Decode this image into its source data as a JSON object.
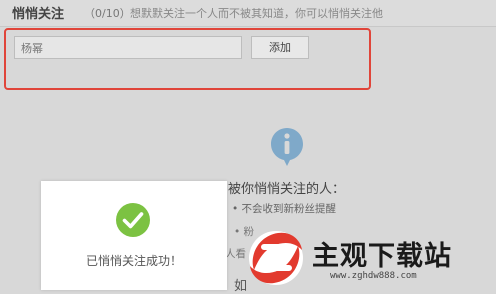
{
  "header": {
    "title": "悄悄关注",
    "count": "（0/10）",
    "description": "想默默关注一个人而不被其知道，你可以悄悄关注他"
  },
  "form": {
    "input_value": "杨幂",
    "add_label": "添加"
  },
  "info_panel": {
    "icon": "info-icon",
    "title": "被你悄悄关注的人：",
    "bullet_1": "• 不会收到新粉丝提醒",
    "fragment_1": "• 粉",
    "fragment_2": "人看",
    "fragment_3": "如"
  },
  "toast": {
    "icon": "check-circle-icon",
    "message": "已悄悄关注成功！"
  },
  "watermark": {
    "title": "主观下载站",
    "url": "www.zghdw888.com"
  },
  "colors": {
    "highlight": "#e0453a",
    "success": "#7cc242",
    "info": "#7fa9c9"
  }
}
